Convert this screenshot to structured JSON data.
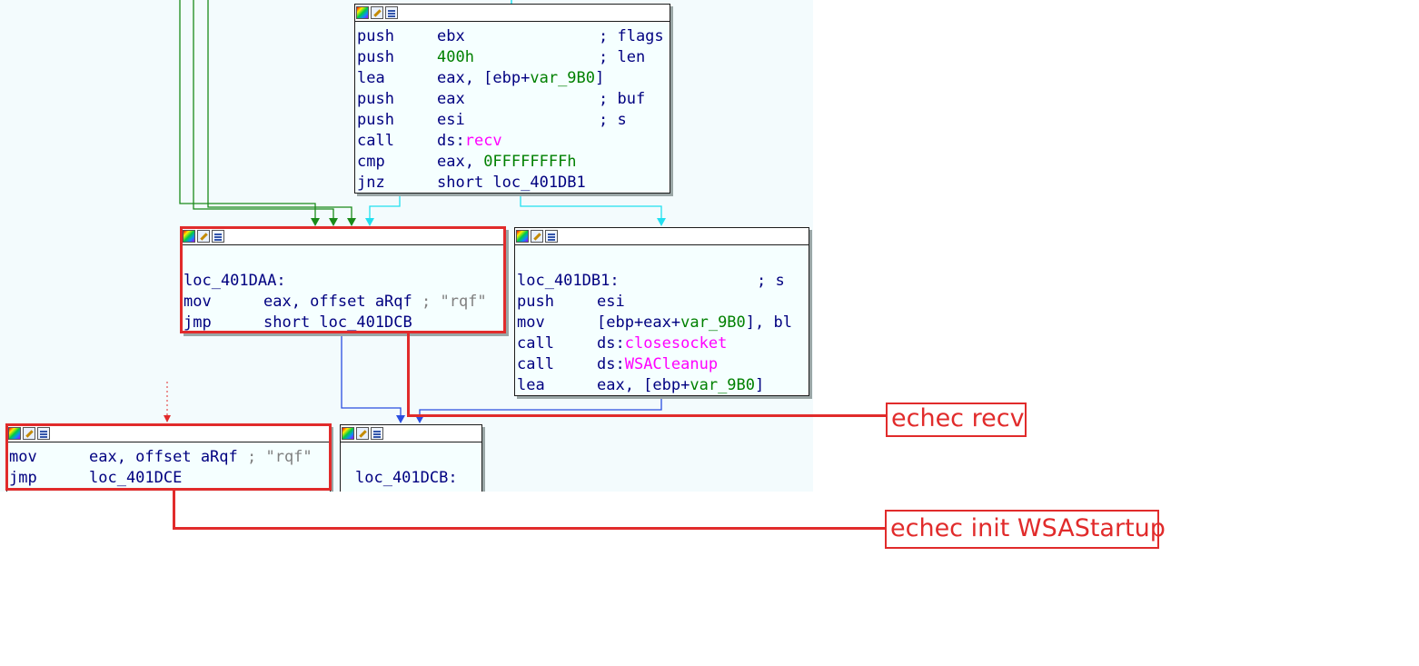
{
  "blocks": {
    "top": {
      "lines": [
        {
          "mn": "push",
          "a": "ebx",
          "comment": "; flags"
        },
        {
          "mn": "push",
          "g": "400h",
          "comment": "; len"
        },
        {
          "mn": "lea",
          "a": "eax, [ebp+",
          "g": "var_9B0",
          "b": "]"
        },
        {
          "mn": "push",
          "a": "eax",
          "comment": "; buf"
        },
        {
          "mn": "push",
          "a": "esi",
          "comment": "; s"
        },
        {
          "mn": "call",
          "a": "ds:",
          "m": "recv"
        },
        {
          "mn": "cmp",
          "a": "eax, ",
          "g": "0FFFFFFFFh"
        },
        {
          "mn": "jnz",
          "a": "short loc_401DB1"
        }
      ]
    },
    "daa": {
      "label": "loc_401DAA:",
      "lines": [
        {
          "mn": "mov",
          "a": "eax, offset aRqf ",
          "gray": "; \"rqf\""
        },
        {
          "mn": "jmp",
          "a": "short loc_401DCB"
        }
      ]
    },
    "db1": {
      "label": "loc_401DB1:",
      "label_comment": "; s",
      "lines": [
        {
          "mn": "push",
          "a": "esi"
        },
        {
          "mn": "mov",
          "a": "[ebp+eax+",
          "g": "var_9B0",
          "b": "], bl"
        },
        {
          "mn": "call",
          "a": "ds:",
          "m": "closesocket"
        },
        {
          "mn": "call",
          "a": "ds:",
          "m": "WSACleanup"
        },
        {
          "mn": "lea",
          "a": "eax, [ebp+",
          "g": "var_9B0",
          "b": "]"
        }
      ]
    },
    "bottom_left": {
      "lines": [
        {
          "mn": "mov",
          "a": "eax, offset aRqf ",
          "gray": "; \"rqf\""
        },
        {
          "mn": "jmp",
          "a": "loc_401DCE"
        }
      ]
    },
    "dcb": {
      "label": "loc_401DCB:"
    }
  },
  "annotations": {
    "recv_fail": "echec recv",
    "wsa_fail": "echec init WSAStartup"
  },
  "colors": {
    "highlight": "#e12b2b",
    "edge_green": "#008000",
    "edge_cyan": "#22e0f0",
    "edge_blue": "#2a4de0",
    "edge_red_dotted": "#e12b2b"
  }
}
